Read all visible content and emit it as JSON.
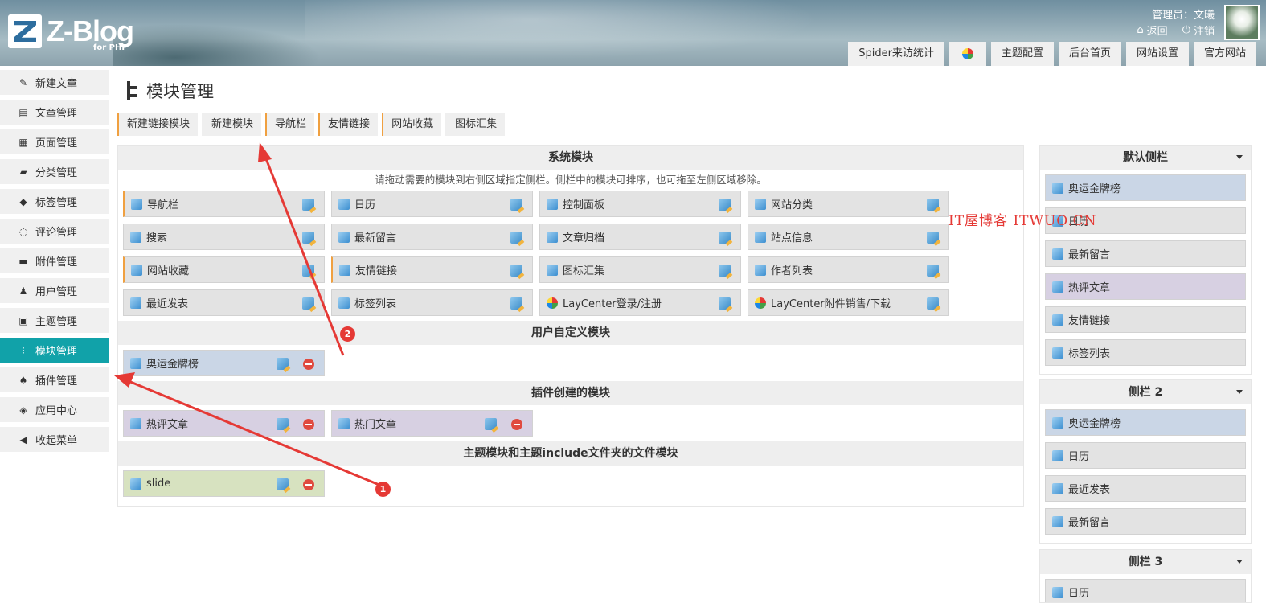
{
  "header": {
    "logo_text": "Z-Blog",
    "logo_sub": "for PHP",
    "admin_label": "管理员：文曦",
    "back_link": "返回",
    "logout_link": "注销",
    "top_tabs": [
      "Spider来访统计",
      "",
      "主题配置",
      "后台首页",
      "网站设置",
      "官方网站"
    ]
  },
  "sidebar": {
    "items": [
      {
        "label": "新建文章",
        "icon": "edit-icon"
      },
      {
        "label": "文章管理",
        "icon": "article-icon"
      },
      {
        "label": "页面管理",
        "icon": "page-icon"
      },
      {
        "label": "分类管理",
        "icon": "folder-icon"
      },
      {
        "label": "标签管理",
        "icon": "tag-icon"
      },
      {
        "label": "评论管理",
        "icon": "comment-icon"
      },
      {
        "label": "附件管理",
        "icon": "attachment-icon"
      },
      {
        "label": "用户管理",
        "icon": "user-icon"
      },
      {
        "label": "主题管理",
        "icon": "theme-icon"
      },
      {
        "label": "模块管理",
        "icon": "module-icon"
      },
      {
        "label": "插件管理",
        "icon": "plugin-icon"
      },
      {
        "label": "应用中心",
        "icon": "app-center-icon"
      },
      {
        "label": "收起菜单",
        "icon": "collapse-icon"
      }
    ],
    "active": "模块管理"
  },
  "main": {
    "title": "模块管理",
    "subtabs": [
      "新建链接模块",
      "新建模块",
      "导航栏",
      "友情链接",
      "网站收藏",
      "图标汇集"
    ],
    "system": {
      "heading": "系统模块",
      "hint": "请拖动需要的模块到右侧区域指定侧栏。侧栏中的模块可排序，也可拖至左侧区域移除。",
      "modules": [
        "导航栏",
        "日历",
        "控制面板",
        "网站分类",
        "搜索",
        "最新留言",
        "文章归档",
        "站点信息",
        "网站收藏",
        "友情链接",
        "图标汇集",
        "作者列表",
        "最近发表",
        "标签列表",
        "LayCenter登录/注册",
        "LayCenter附件销售/下载"
      ]
    },
    "user_defined": {
      "heading": "用户自定义模块",
      "modules": [
        "奥运金牌榜"
      ]
    },
    "plugin": {
      "heading": "插件创建的模块",
      "modules": [
        "热评文章",
        "热门文章"
      ]
    },
    "theme": {
      "heading": "主题模块和主题include文件夹的文件模块",
      "modules": [
        "slide"
      ]
    }
  },
  "right": {
    "sidebars": [
      {
        "title": "默认侧栏",
        "modules": [
          "奥运金牌榜",
          "日历",
          "最新留言",
          "热评文章",
          "友情链接",
          "标签列表"
        ]
      },
      {
        "title": "侧栏 2",
        "modules": [
          "奥运金牌榜",
          "日历",
          "最近发表",
          "最新留言"
        ]
      },
      {
        "title": "侧栏 3",
        "modules": [
          "日历"
        ]
      }
    ]
  },
  "annotations": {
    "watermark": "IT屋博客 ITWUO.CN",
    "badge1": "1",
    "badge2": "2"
  },
  "colors": {
    "active_sidebar": "#11a2a9",
    "accent_orange": "#f0a040",
    "annotation_red": "#e53935"
  }
}
